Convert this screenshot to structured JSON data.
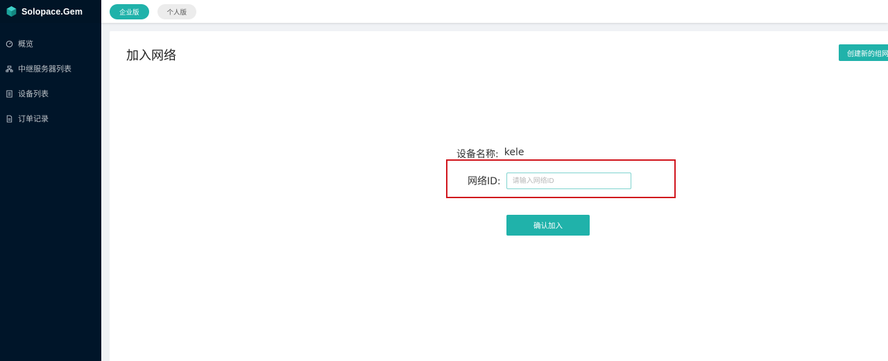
{
  "app": {
    "logo_text": "Solopace.Gem",
    "logo_icon": "cube-icon",
    "accent_color": "#20b2aa"
  },
  "sidebar": {
    "items": [
      {
        "label": "概览",
        "icon": "dashboard-icon"
      },
      {
        "label": "中继服务器列表",
        "icon": "server-icon"
      },
      {
        "label": "设备列表",
        "icon": "device-list-icon"
      },
      {
        "label": "订单记录",
        "icon": "document-icon"
      }
    ]
  },
  "topbar": {
    "tabs": [
      {
        "label": "企业版",
        "active": true
      },
      {
        "label": "个人版",
        "active": false
      }
    ]
  },
  "main": {
    "title": "加入网络",
    "create_button": "创建新的组网",
    "device_label": "设备名称:",
    "device_value": "kele",
    "network_label": "网络ID:",
    "network_placeholder": "请输入网络ID",
    "network_value": "",
    "confirm_button": "确认加入",
    "highlight_color": "#d0141c"
  }
}
